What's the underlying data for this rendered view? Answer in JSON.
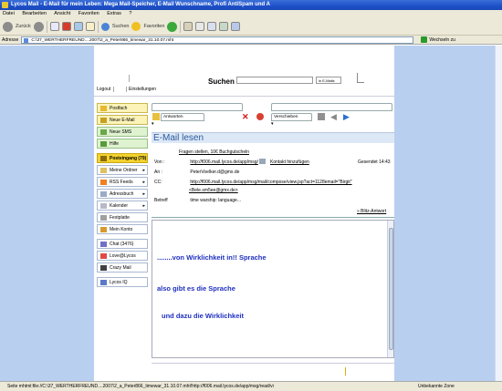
{
  "window": {
    "title": "Lycos Mail - E-Mail für mein Leben: Mega Mail-Speicher, E-Mail Wunschname, Profi AntiSpam und A"
  },
  "menu": [
    "Datei",
    "Bearbeiten",
    "Ansicht",
    "Favoriten",
    "Extras",
    "?"
  ],
  "toolbar": {
    "back": "Zurück",
    "search": "Suchen",
    "favorites": "Favoriten"
  },
  "addressbar": {
    "label": "Adresse",
    "url": "C:\\37_WERTHERFREUND....2007\\2_a_Peter866_timewar_31.10.07.mht",
    "go": "Wechseln zu"
  },
  "header": {
    "search_label": "Suchen",
    "search_scope": "in E-Mails",
    "logout": "Logout",
    "settings": "Einstellungen"
  },
  "sidebar": [
    {
      "label": "Postfach",
      "style": "yellow"
    },
    {
      "label": "Neue E-Mail",
      "style": "yellow"
    },
    {
      "label": "Neue SMS",
      "style": "green"
    },
    {
      "label": "Hilfe",
      "style": "green"
    },
    {
      "label": "Posteingang (79)",
      "style": "active"
    },
    {
      "label": "Meine Ordner",
      "style": "plain"
    },
    {
      "label": "RSS Feeds",
      "style": "plain"
    },
    {
      "label": "Adressbuch",
      "style": "plain"
    },
    {
      "label": "Kalender",
      "style": "plain"
    },
    {
      "label": "Festplatte",
      "style": "plain"
    },
    {
      "label": "Mein Konto",
      "style": "plain"
    },
    {
      "label": "Chat (3476)",
      "style": "plain"
    },
    {
      "label": "Love@Lycos",
      "style": "plain"
    },
    {
      "label": "Crazy Mail",
      "style": "plain"
    },
    {
      "label": "Lycos IQ",
      "style": "plain"
    }
  ],
  "actions": {
    "reply": "Antworten",
    "move": "Verschieben"
  },
  "email": {
    "title": "E-Mail lesen",
    "subject_line": "Fragen stellen, 10€ Buchgutscheln",
    "from_label": "Von :",
    "from": "http://f006.mail.lycos.de/app/msg/",
    "add_contact": "Kontakt hinzufügen",
    "received": "Gesendet 14:43",
    "to_label": "An :",
    "to": "PeterVoelker.d@gmx.de",
    "cc_label": "CC:",
    "cc": "http://f006.mail.lycos.de/app/msg/mail/compose/view.jsp?act=1128email=\"Birgit\"",
    "cc2": "<Bele.sm5ee@gmx.de>",
    "subject_label": "Betreff",
    "subject": "time warship: language...",
    "quick_reply": "» Blitz-Antwort",
    "body": [
      "........von Wirklichkeit in!!   Sprache",
      "also gibt es die Sprache",
      "und dazu die Wirklichkeit"
    ]
  },
  "status": {
    "left": "Seite mhtml:file://C:\\37_WERTHERFREUND....2007\\2_a_Peter866_timewar_31.10.07.mht!http://f006.mail.lycos.de/app/msg/read/vi",
    "zone": "Unbekannte Zone"
  }
}
